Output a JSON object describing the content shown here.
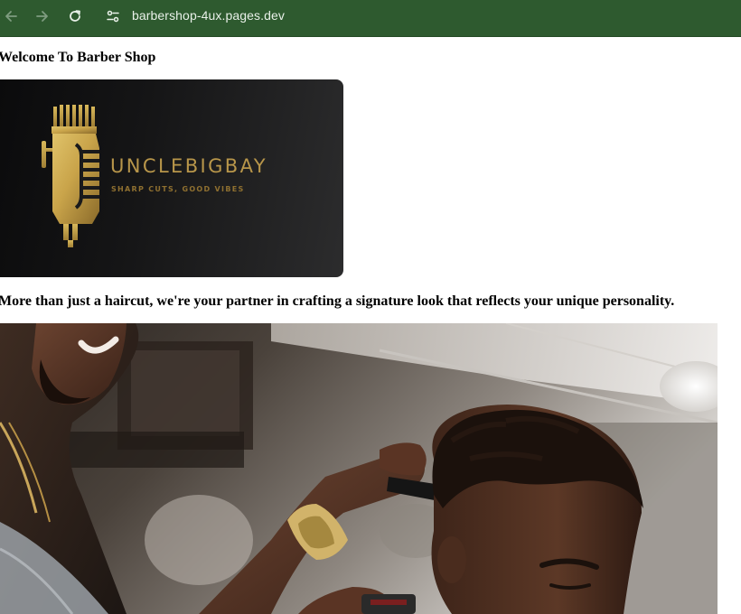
{
  "browser": {
    "url": "barbershop-4ux.pages.dev",
    "theme_color": "#2e5a2f",
    "icons": {
      "back": "arrow-left-icon",
      "forward": "arrow-right-icon",
      "reload": "reload-icon",
      "site_info": "site-settings-icon"
    }
  },
  "page": {
    "title": "Welcome To Barber Shop",
    "intro": "More than just a haircut, we're your partner in crafting a signature look that reflects your unique personality."
  },
  "logo": {
    "brand_name": "UNCLEBIGBAY",
    "tagline": "SHARP CUTS, GOOD VIBES",
    "accent_color": "#b8964a"
  },
  "hero_image": {
    "description_icon": "barber-photo"
  }
}
